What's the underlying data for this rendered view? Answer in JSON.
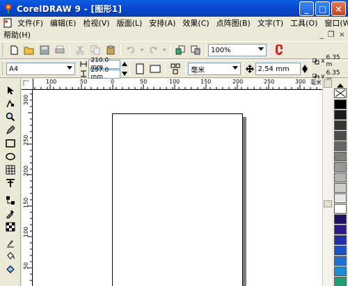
{
  "window": {
    "title": "CorelDRAW 9 - [图形1]",
    "minimize": "_",
    "maximize": "□",
    "close": "×"
  },
  "menu": {
    "items": [
      "文件(F)",
      "编辑(E)",
      "检视(V)",
      "版面(L)",
      "安排(A)",
      "效果(C)",
      "点阵图(B)",
      "文字(T)",
      "工具(O)",
      "窗口(W)"
    ],
    "help": "帮助(H)",
    "mdi_minimize": "_",
    "mdi_restore": "❐",
    "mdi_close": "×"
  },
  "standard_toolbar": {
    "zoom": "100%"
  },
  "property_bar": {
    "paper": "A4",
    "width": "210.0 mm",
    "height": "297.0 mm",
    "units": "毫米",
    "nudge": "2.54 mm",
    "dup_x": "6.35 m",
    "dup_y": "6.35 m",
    "dup_x_label": "x",
    "dup_y_label": "y"
  },
  "rulers": {
    "unit": "毫米",
    "h_labels": [
      "100",
      "50",
      "0",
      "50",
      "100",
      "150",
      "200",
      "250",
      "300"
    ],
    "v_labels": [
      "300",
      "250",
      "200",
      "150",
      "100",
      "50"
    ]
  },
  "palette": {
    "colors": [
      "#000000",
      "#1a1a1a",
      "#333333",
      "#4d4d4d",
      "#666666",
      "#808080",
      "#999999",
      "#b3b3b3",
      "#cccccc",
      "#e6e6e6",
      "#ffffff",
      "#1e1060",
      "#2b1a8c",
      "#1f2fa8",
      "#1a4fc8",
      "#1e6fd8",
      "#208cd8",
      "#20a070"
    ]
  }
}
